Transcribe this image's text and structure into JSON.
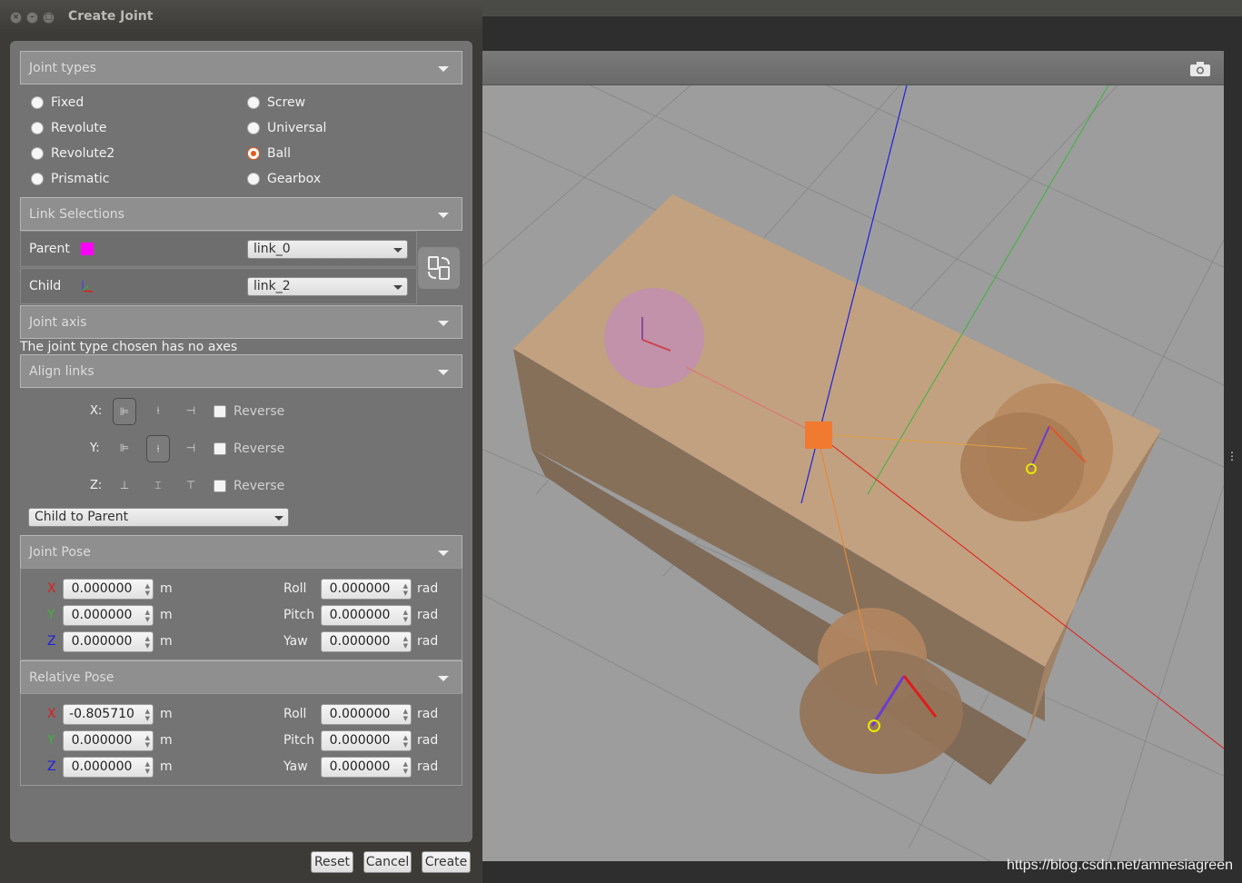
{
  "window": {
    "title": "Create Joint"
  },
  "sections": {
    "joint_types": "Joint types",
    "link_selections": "Link Selections",
    "joint_axis": "Joint axis",
    "align_links": "Align links",
    "joint_pose": "Joint Pose",
    "relative_pose": "Relative Pose"
  },
  "joint_types": [
    {
      "label": "Fixed",
      "selected": false
    },
    {
      "label": "Revolute",
      "selected": false
    },
    {
      "label": "Revolute2",
      "selected": false
    },
    {
      "label": "Prismatic",
      "selected": false
    },
    {
      "label": "Screw",
      "selected": false
    },
    {
      "label": "Universal",
      "selected": false
    },
    {
      "label": "Ball",
      "selected": true
    },
    {
      "label": "Gearbox",
      "selected": false
    }
  ],
  "links": {
    "parent_label": "Parent",
    "parent_value": "link_0",
    "parent_color": "#ff00ff",
    "child_label": "Child",
    "child_value": "link_2",
    "swap_icon": "swap-icon"
  },
  "joint_axis_message": "The joint type chosen has no axes",
  "align": {
    "x_label": "X:",
    "y_label": "Y:",
    "z_label": "Z:",
    "reverse_label": "Reverse",
    "selected": {
      "x": "min",
      "y": "center",
      "z": "none"
    },
    "mode": "Child to Parent"
  },
  "joint_pose": {
    "x": "0.000000",
    "y": "0.000000",
    "z": "0.000000",
    "roll": "0.000000",
    "pitch": "0.000000",
    "yaw": "0.000000"
  },
  "relative_pose": {
    "x": "-0.805710",
    "y": "0.000000",
    "z": "0.000000",
    "roll": "0.000000",
    "pitch": "0.000000",
    "yaw": "0.000000"
  },
  "pose_labels": {
    "x": "X",
    "y": "Y",
    "z": "Z",
    "roll": "Roll",
    "pitch": "Pitch",
    "yaw": "Yaw",
    "unit_len": "m",
    "unit_ang": "rad"
  },
  "axis_colors": {
    "x": "#e01b1b",
    "y": "#3cb43c",
    "z": "#2020e0"
  },
  "buttons": {
    "reset": "Reset",
    "cancel": "Cancel",
    "create": "Create"
  },
  "watermark": "https://blog.csdn.net/amnesiagreen"
}
